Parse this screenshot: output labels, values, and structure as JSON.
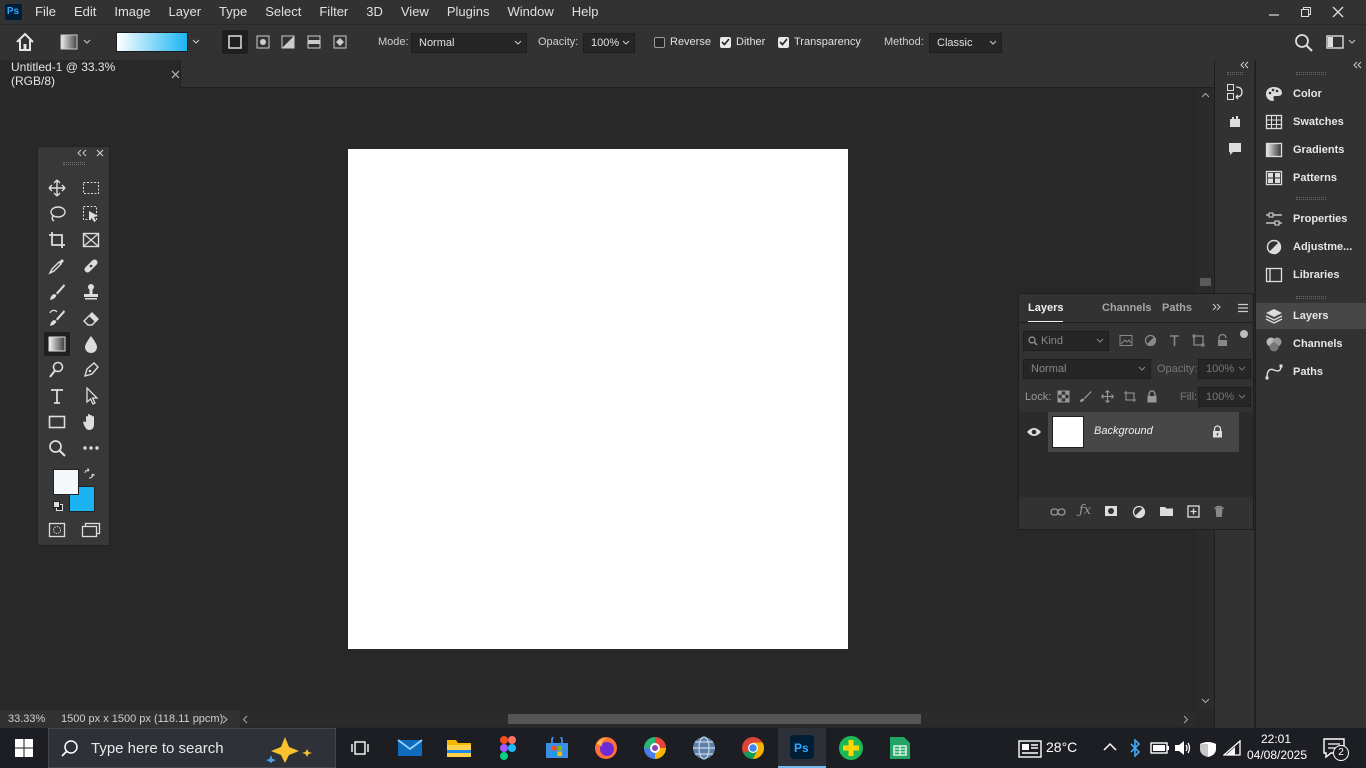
{
  "menubar": {
    "items": [
      "File",
      "Edit",
      "Image",
      "Layer",
      "Type",
      "Select",
      "Filter",
      "3D",
      "View",
      "Plugins",
      "Window",
      "Help"
    ]
  },
  "options": {
    "mode_label": "Mode:",
    "mode_value": "Normal",
    "opacity_label": "Opacity:",
    "opacity_value": "100%",
    "reverse_label": "Reverse",
    "reverse_checked": false,
    "dither_label": "Dither",
    "dither_checked": true,
    "transparency_label": "Transparency",
    "transparency_checked": true,
    "method_label": "Method:",
    "method_value": "Classic",
    "gradient_start_color": "#ffffff",
    "gradient_end_color": "#1ab4f2"
  },
  "document": {
    "tab_title": "Untitled-1 @ 33.3% (RGB/8)",
    "zoom": "33.33%",
    "doc_info": "1500 px x 1500 px (118.11 ppcm)"
  },
  "colors": {
    "foreground": "#f4f8fa",
    "background": "#1ab4f2",
    "accent": "#31a8ff"
  },
  "right_panel": {
    "items": [
      "Color",
      "Swatches",
      "Gradients",
      "Patterns",
      "Properties",
      "Adjustme...",
      "Libraries",
      "Layers",
      "Channels",
      "Paths"
    ]
  },
  "layers_panel": {
    "tabs": [
      "Layers",
      "Channels",
      "Paths"
    ],
    "search_placeholder": "Kind",
    "blend_mode": "Normal",
    "opacity_label": "Opacity:",
    "opacity_value": "100%",
    "lock_label": "Lock:",
    "fill_label": "Fill:",
    "fill_value": "100%",
    "layers": [
      {
        "name": "Background",
        "visible": true,
        "locked": true
      }
    ]
  },
  "taskbar": {
    "search_placeholder": "Type here to search",
    "temperature": "28°C",
    "time": "22:01",
    "date": "04/08/2025",
    "notification_count": "2"
  }
}
